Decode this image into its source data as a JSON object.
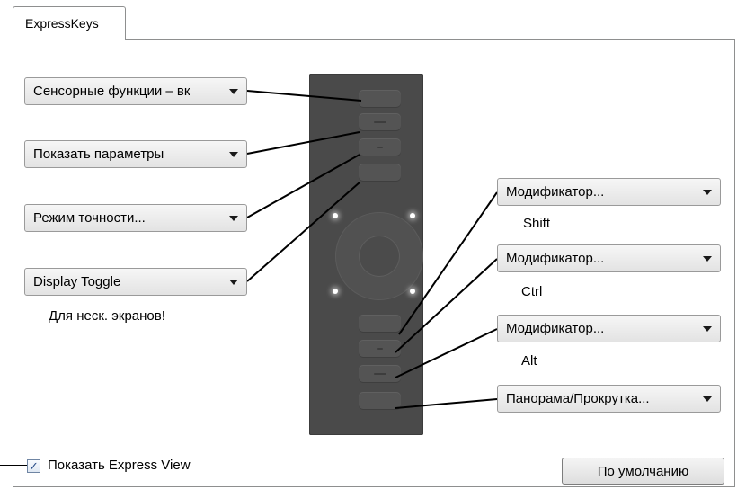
{
  "tab": {
    "label": "ExpressKeys"
  },
  "left_dropdowns": [
    {
      "label": "Сенсорные функции – вк"
    },
    {
      "label": "Показать параметры"
    },
    {
      "label": "Режим точности..."
    },
    {
      "label": "Display Toggle"
    }
  ],
  "left_note": "Для неск. экранов!",
  "right_dropdowns": [
    {
      "label": "Модификатор...",
      "sub": "Shift"
    },
    {
      "label": "Модификатор...",
      "sub": "Ctrl"
    },
    {
      "label": "Модификатор...",
      "sub": "Alt"
    },
    {
      "label": "Панорама/Прокрутка...",
      "sub": ""
    }
  ],
  "show_express_view": {
    "label": "Показать Express View",
    "checked": true,
    "glyph": "✓"
  },
  "default_button": {
    "label": "По умолчанию"
  },
  "colors": {
    "device": "#4a4a4a",
    "led": "#ffffff"
  }
}
